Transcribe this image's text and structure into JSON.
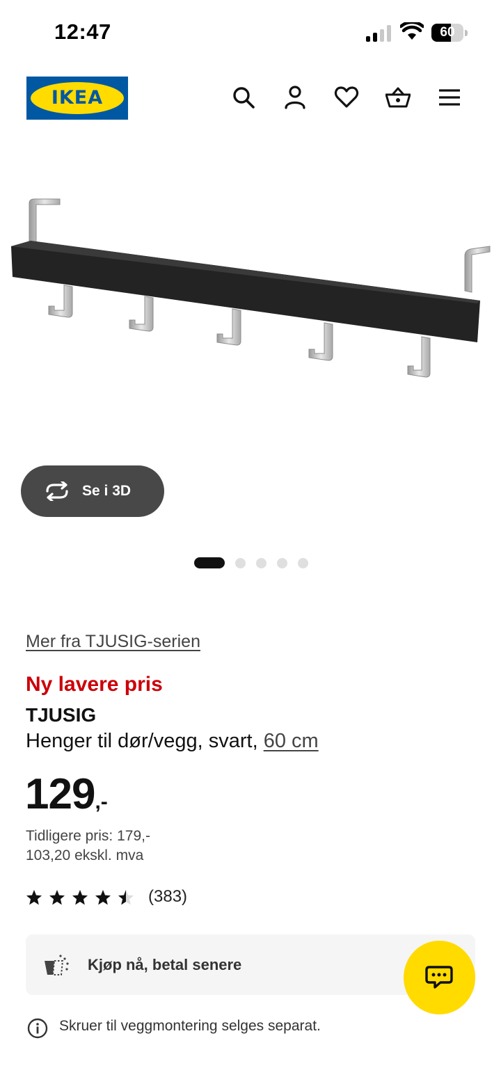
{
  "status_bar": {
    "time": "12:47",
    "battery_percent": 60,
    "battery_label": "60"
  },
  "header": {
    "logo_text": "IKEA",
    "icons": [
      "search-icon",
      "account-icon",
      "heart-icon",
      "cart-icon",
      "menu-icon"
    ]
  },
  "product": {
    "see_3d_label": "Se i 3D",
    "image_count": 5,
    "active_image": 1,
    "series_link": "Mer fra TJUSIG-serien",
    "badge": "Ny lavere pris",
    "name": "TJUSIG",
    "description": "Henger til dør/vegg, svart, ",
    "size": "60 cm",
    "price_int": "129",
    "price_dec": ",-",
    "previous_price": "Tidligere pris: 179,-",
    "price_ex_vat": "103,20 ekskl. mva",
    "rating": 4.5,
    "rating_max": 5,
    "review_count": "(383)"
  },
  "bnpl_label": "Kjøp nå, betal senere",
  "notice": "Skruer til veggmontering selges separat.",
  "colors": {
    "accent_red": "#cc0008",
    "ikea_blue": "#0058a3",
    "ikea_yellow": "#ffdb00"
  }
}
